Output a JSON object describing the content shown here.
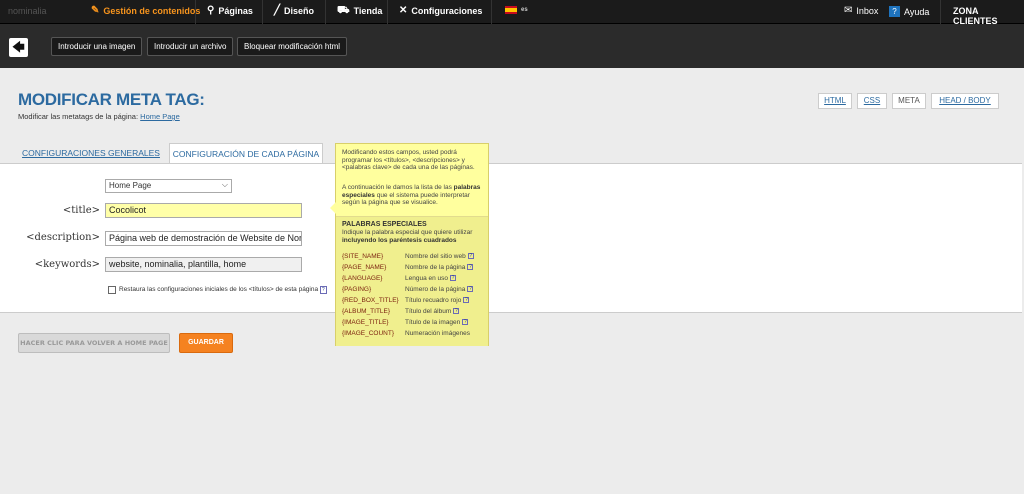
{
  "topnav": {
    "logo": "nominalia",
    "items": [
      {
        "label": "Gestión de contenidos"
      },
      {
        "label": "Páginas"
      },
      {
        "label": "Diseño"
      },
      {
        "label": "Tienda"
      },
      {
        "label": "Configuraciones"
      }
    ],
    "language": "es",
    "inbox": "Inbox",
    "help": "Ayuda",
    "help_icon": "?",
    "client_zone": "ZONA CLIENTES"
  },
  "toolbar": {
    "back_icon": "🡄",
    "insert_image": "Introducir una imagen",
    "insert_file": "Introducir un archivo",
    "lock_html": "Bloquear modificación html"
  },
  "header": {
    "title": "MODIFICAR META TAG:",
    "subtitle_prefix": "Modificar las metatags de la página:",
    "subtitle_link": "Home Page",
    "tabs": [
      "HTML",
      "CSS",
      "META",
      "HEAD / BODY"
    ]
  },
  "tabs": {
    "general": "CONFIGURACIONES GENERALES",
    "each_page": "CONFIGURACIÓN DE CADA PÁGINA"
  },
  "form": {
    "page_select": "Home Page",
    "title_label": "<title>",
    "title_value": "Cocolicot",
    "desc_label": "<description>",
    "desc_value": "Página web de demostración de Website de Nor",
    "keywords_label": "<keywords>",
    "keywords_value": "website, nominalia, plantilla, home",
    "restore_label": "Restaura las configuraciones iniciales de los <títulos> de esta página",
    "restore_help": "?"
  },
  "buttons": {
    "back_home": "HACER CLIC PARA VOLVER A HOME PAGE",
    "save": "GUARDAR"
  },
  "tooltip": {
    "p1": "Modificando estos campos, usted podrá programar los <títulos>, <descripciones> y <palabras clave> de cada una de las páginas.",
    "p2_prefix": "A continuación le damos la lista de las",
    "p2_bold": "palabras especiales",
    "p2_suffix": "que el sistema puede interpretar según la página que se visualice.",
    "specials_title": "PALABRAS ESPECIALES",
    "specials_desc": "Indique la palabra especial que quiere utilizar",
    "specials_desc_bold": "incluyendo los paréntesis cuadrados",
    "help_mark": "?",
    "rows": [
      {
        "code": "{SITE_NAME}",
        "desc": "Nombre del sitio web"
      },
      {
        "code": "{PAGE_NAME}",
        "desc": "Nombre de la página"
      },
      {
        "code": "{LANGUAGE}",
        "desc": "Lengua en uso"
      },
      {
        "code": "{PAGING}",
        "desc": "Número de la página"
      },
      {
        "code": "{RED_BOX_TITLE}",
        "desc": "Título recuadro rojo"
      },
      {
        "code": "{ALBUM_TITLE}",
        "desc": "Título del álbum"
      },
      {
        "code": "{IMAGE_TITLE}",
        "desc": "Título de la imagen"
      },
      {
        "code": "{IMAGE_COUNT}",
        "desc": "Numeración imágenes"
      }
    ]
  },
  "colors": {
    "accent": "#f7941d",
    "link": "#2c6aa0",
    "tooltip_bg": "#ffff9e",
    "title_field_bg": "#ffffa8"
  }
}
